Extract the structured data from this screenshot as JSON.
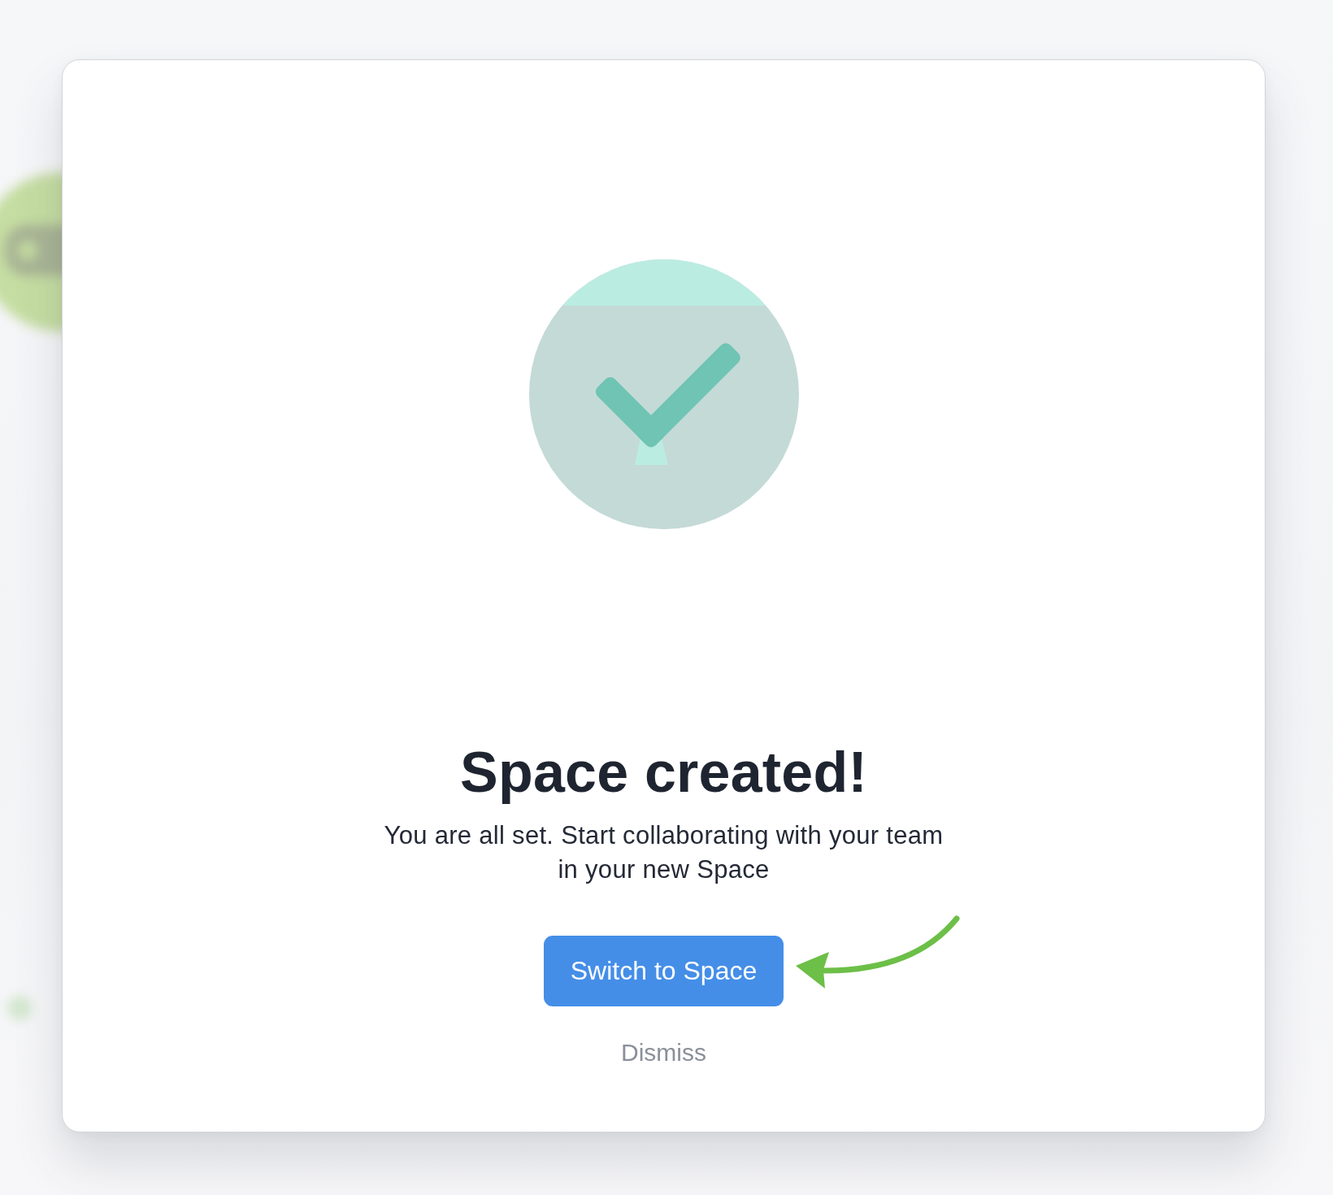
{
  "dialog": {
    "title": "Space created!",
    "message": "You are all set. Start collaborating with your team in your new Space",
    "primary_button": "Switch to Space",
    "secondary_button": "Dismiss"
  }
}
